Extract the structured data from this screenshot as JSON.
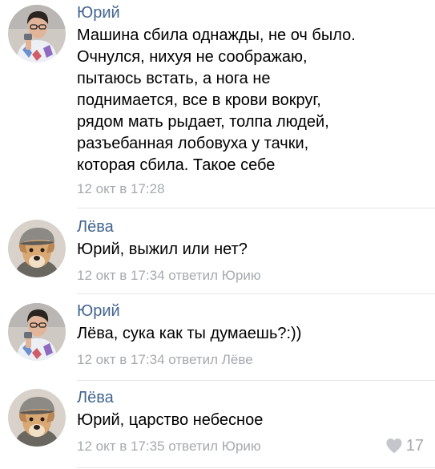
{
  "comments": [
    {
      "author": "Юрий",
      "avatar": "yuri-avatar",
      "text_lines": [
        "Машина сбила однажды, не оч было.",
        "Очнулся, нихуя не соображаю,",
        "пытаюсь встать, а нога не",
        "поднимается, все в крови вокруг,",
        "рядом мать рыдает, толпа людей,",
        "разъебанная лобовуха у тачки,",
        "которая сбила. Такое себе"
      ],
      "meta": "12 окт в 17:28"
    },
    {
      "author": "Лёва",
      "avatar": "dog-avatar",
      "text_lines": [
        "Юрий, выжил или нет?"
      ],
      "meta": "12 окт в 17:34 ответил Юрию"
    },
    {
      "author": "Юрий",
      "avatar": "yuri-avatar",
      "text_lines": [
        "Лёва, сука как ты думаешь?:))"
      ],
      "meta": "12 окт в 17:34 ответил Лёве"
    },
    {
      "author": "Лёва",
      "avatar": "dog-avatar",
      "text_lines": [
        "Юрий, царство небесное"
      ],
      "meta": "12 окт в 17:35 ответил Юрию",
      "likes": "17",
      "likes_icon": "heart-icon"
    }
  ],
  "colors": {
    "author": "#43658f",
    "meta": "#a5a9ae",
    "text": "#000000",
    "divider": "#e3e5e8"
  }
}
